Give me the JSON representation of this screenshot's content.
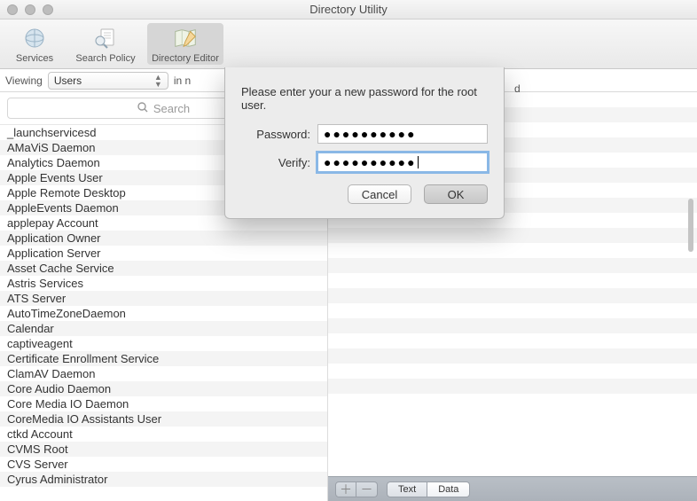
{
  "window": {
    "title": "Directory Utility"
  },
  "toolbar": {
    "items": [
      {
        "label": "Services"
      },
      {
        "label": "Search Policy"
      },
      {
        "label": "Directory Editor"
      }
    ],
    "selected_index": 2
  },
  "filterbar": {
    "viewing_label": "Viewing",
    "select_value": "Users",
    "after_text": "in n",
    "trailing_visible": "d"
  },
  "search": {
    "placeholder": "Search"
  },
  "users": [
    "_launchservicesd",
    "AMaViS Daemon",
    "Analytics Daemon",
    "Apple Events User",
    "Apple Remote Desktop",
    "AppleEvents Daemon",
    "applepay Account",
    "Application Owner",
    "Application Server",
    "Asset Cache Service",
    "Astris Services",
    "ATS Server",
    "AutoTimeZoneDaemon",
    "Calendar",
    "captiveagent",
    "Certificate Enrollment Service",
    "ClamAV Daemon",
    "Core Audio Daemon",
    "Core Media IO Daemon",
    "CoreMedia IO Assistants User",
    "ctkd Account",
    "CVMS Root",
    "CVS Server",
    "Cyrus Administrator"
  ],
  "footer": {
    "plus": "＋",
    "minus": "－",
    "seg_left": "Text",
    "seg_right": "Data"
  },
  "sheet": {
    "prompt": "Please enter your a new password for the root user.",
    "password_label": "Password:",
    "verify_label": "Verify:",
    "password_masked": "●●●●●●●●●●",
    "verify_masked": "●●●●●●●●●●",
    "cancel": "Cancel",
    "ok": "OK"
  }
}
